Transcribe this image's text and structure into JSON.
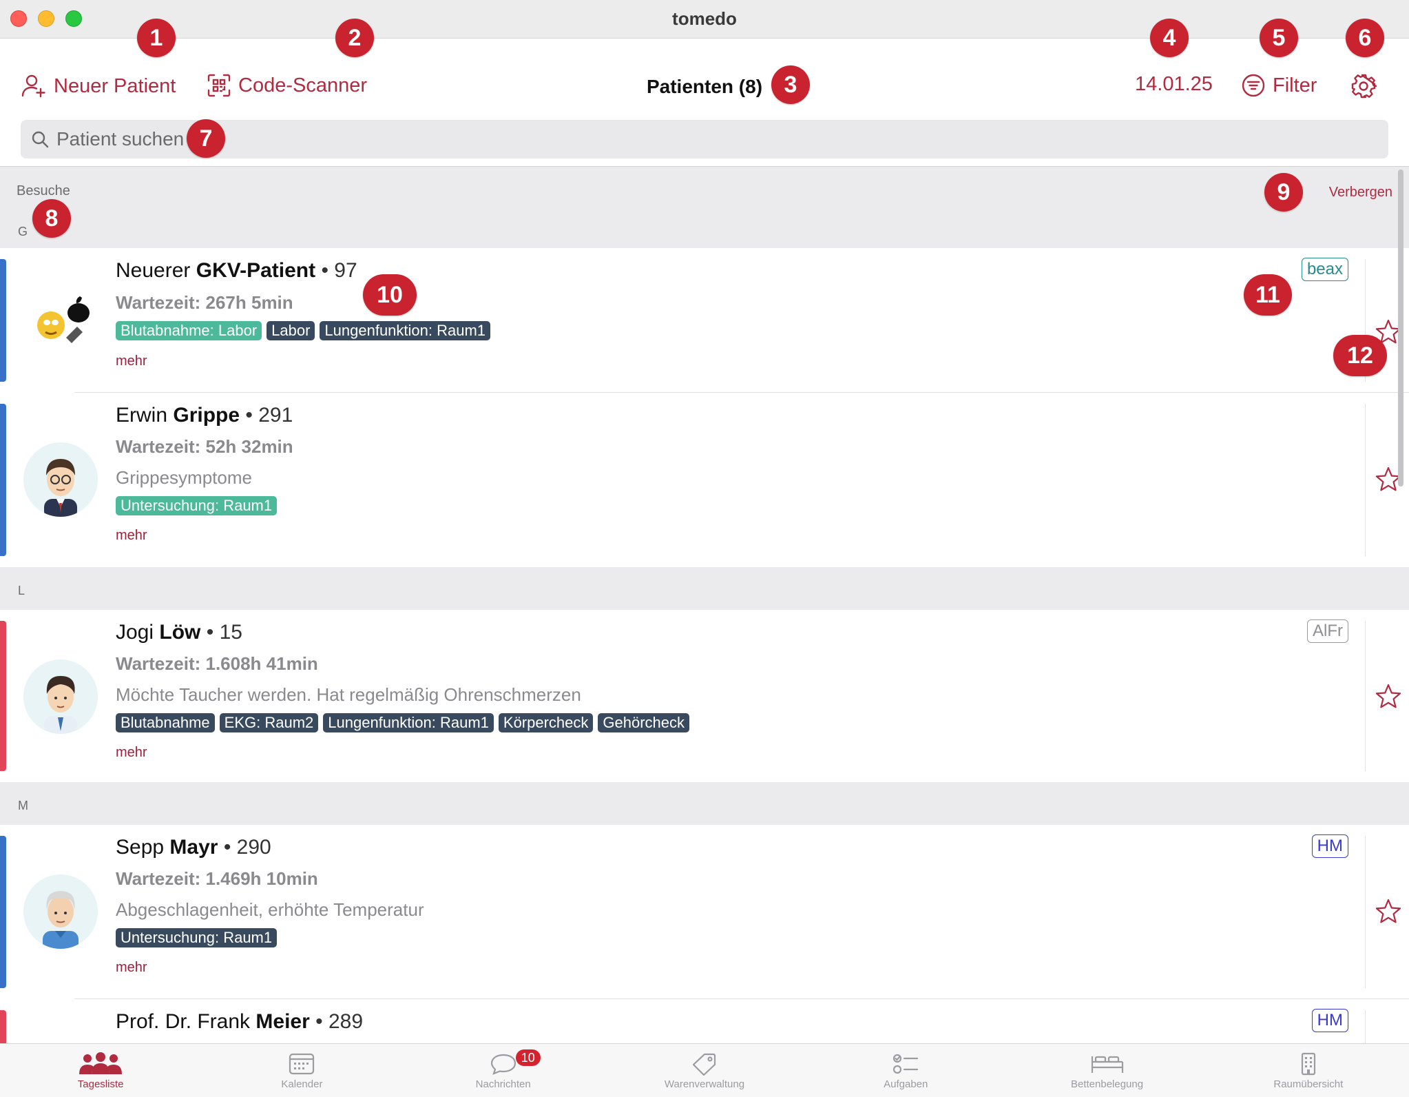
{
  "window": {
    "title": "tomedo"
  },
  "toolbar": {
    "new_patient": "Neuer Patient",
    "code_scanner": "Code-Scanner",
    "title": "Patienten (8)",
    "date": "14.01.25",
    "filter": "Filter",
    "settings_icon": "gear-icon"
  },
  "search": {
    "placeholder": "Patient suchen"
  },
  "visits_header": {
    "label": "Besuche",
    "group": "G",
    "hide": "Verbergen"
  },
  "patients": [
    {
      "first": "Neuerer",
      "last": "GKV-Patient",
      "num": "• 97",
      "wait": "Wartezeit: 267h 5min",
      "desc": "",
      "tags": [
        {
          "label": "Blutabnahme: Labor",
          "style": "green"
        },
        {
          "label": "Labor",
          "style": "dark"
        },
        {
          "label": "Lungenfunktion: Raum1",
          "style": "dark"
        }
      ],
      "more": "mehr",
      "badge": "beax",
      "badge_color": "#2a8a8e",
      "bar_color": "#3670c8"
    },
    {
      "first": "Erwin",
      "last": "Grippe",
      "num": "• 291",
      "wait": "Wartezeit: 52h 32min",
      "desc": "Grippesymptome",
      "tags": [
        {
          "label": "Untersuchung: Raum1",
          "style": "green"
        }
      ],
      "more": "mehr",
      "badge": "",
      "bar_color": "#3670c8"
    },
    {
      "first": "Jogi",
      "last": "Löw",
      "num": "• 15",
      "wait": "Wartezeit: 1.608h 41min",
      "desc": "Möchte Taucher werden. Hat regelmäßig Ohrenschmerzen",
      "tags": [
        {
          "label": "Blutabnahme",
          "style": "dark"
        },
        {
          "label": "EKG: Raum2",
          "style": "dark"
        },
        {
          "label": "Lungenfunktion: Raum1",
          "style": "dark"
        },
        {
          "label": "Körpercheck",
          "style": "dark"
        },
        {
          "label": "Gehörcheck",
          "style": "dark"
        }
      ],
      "more": "mehr",
      "badge": "AlFr",
      "badge_color": "#8e8e93",
      "bar_color": "#e0455a"
    },
    {
      "first": "Sepp",
      "last": "Mayr",
      "num": "• 290",
      "wait": "Wartezeit: 1.469h 10min",
      "desc": "Abgeschlagenheit, erhöhte Temperatur",
      "tags": [
        {
          "label": "Untersuchung: Raum1",
          "style": "dark"
        }
      ],
      "more": "mehr",
      "badge": "HM",
      "badge_color": "#3a3ad0",
      "bar_color": "#3670c8"
    },
    {
      "first": "Prof. Dr. Frank",
      "last": "Meier",
      "num": "• 289",
      "badge": "HM",
      "badge_color": "#3a3ad0",
      "bar_color": "#e0455a"
    }
  ],
  "sections": {
    "l": "L",
    "m": "M"
  },
  "tabbar": [
    {
      "label": "Tagesliste",
      "icon": "people-icon",
      "active": true
    },
    {
      "label": "Kalender",
      "icon": "calendar-icon"
    },
    {
      "label": "Nachrichten",
      "icon": "chat-bubble-icon",
      "count": "10"
    },
    {
      "label": "Warenverwaltung",
      "icon": "tag-icon"
    },
    {
      "label": "Aufgaben",
      "icon": "checklist-icon"
    },
    {
      "label": "Bettenbelegung",
      "icon": "bed-icon"
    },
    {
      "label": "Raumübersicht",
      "icon": "building-icon"
    }
  ],
  "markers": [
    "1",
    "2",
    "3",
    "4",
    "5",
    "6",
    "7",
    "8",
    "9",
    "10",
    "11",
    "12"
  ],
  "colors": {
    "accent": "#b02a40",
    "marker": "#c8232e",
    "tag_green": "#4cb99a",
    "tag_dark": "#394a5e"
  }
}
